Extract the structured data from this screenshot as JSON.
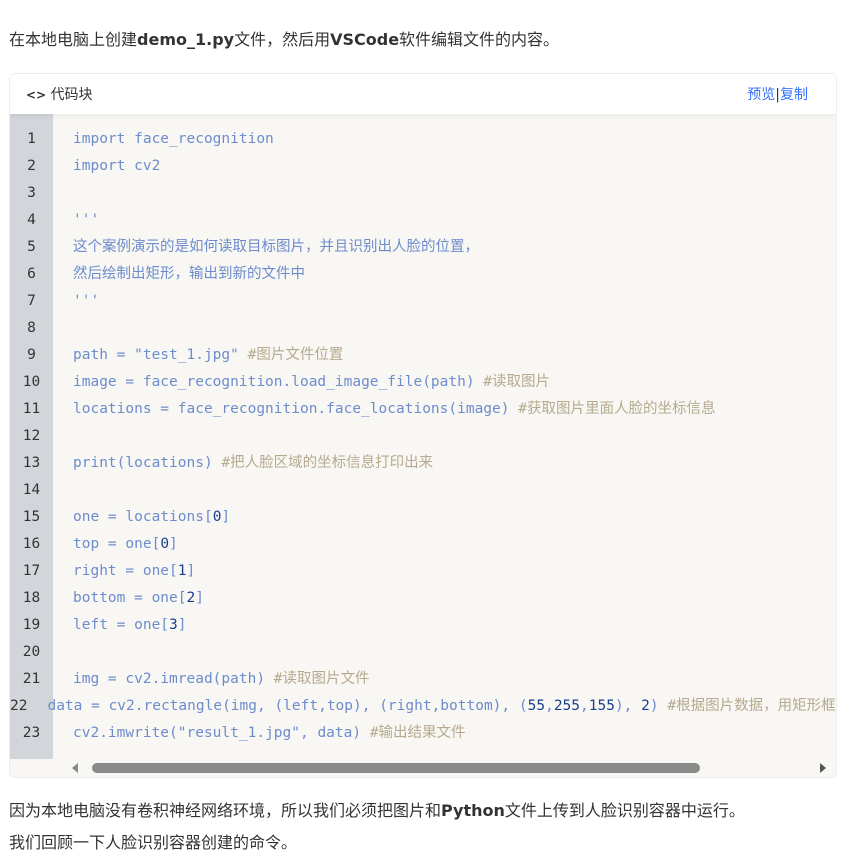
{
  "intro": {
    "pre": "在本地电脑上创建",
    "file": "demo_1.py",
    "mid": "文件，然后用",
    "app": "VSCode",
    "post": "软件编辑文件的内容。"
  },
  "codeblock": {
    "icon": "code-icon",
    "icon_text": "<>",
    "title": "代码块",
    "preview": "预览",
    "sep": "|",
    "copy": "复制"
  },
  "lines": [
    [
      [
        "k",
        "import face_recognition"
      ]
    ],
    [
      [
        "k",
        "import cv2"
      ]
    ],
    [],
    [
      [
        "k",
        "'''"
      ]
    ],
    [
      [
        "k",
        "这个案例演示的是如何读取目标图片，并且识别出人脸的位置，"
      ]
    ],
    [
      [
        "k",
        "然后绘制出矩形，输出到新的文件中"
      ]
    ],
    [
      [
        "k",
        "'''"
      ]
    ],
    [],
    [
      [
        "k",
        "path = "
      ],
      [
        "s",
        "\"test_1.jpg\""
      ],
      [
        "c",
        " #图片文件位置"
      ]
    ],
    [
      [
        "k",
        "image = face_recognition.load_image_file(path)"
      ],
      [
        "c",
        " #读取图片"
      ]
    ],
    [
      [
        "k",
        "locations = face_recognition.face_locations(image)"
      ],
      [
        "c",
        " #获取图片里面人脸的坐标信息"
      ]
    ],
    [],
    [
      [
        "k",
        "print(locations)"
      ],
      [
        "c",
        " #把人脸区域的坐标信息打印出来"
      ]
    ],
    [],
    [
      [
        "k",
        "one = locations["
      ],
      [
        "n",
        "0"
      ],
      [
        "k",
        "]"
      ]
    ],
    [
      [
        "k",
        "top = one["
      ],
      [
        "n",
        "0"
      ],
      [
        "k",
        "]"
      ]
    ],
    [
      [
        "k",
        "right = one["
      ],
      [
        "n",
        "1"
      ],
      [
        "k",
        "]"
      ]
    ],
    [
      [
        "k",
        "bottom = one["
      ],
      [
        "n",
        "2"
      ],
      [
        "k",
        "]"
      ]
    ],
    [
      [
        "k",
        "left = one["
      ],
      [
        "n",
        "3"
      ],
      [
        "k",
        "]"
      ]
    ],
    [],
    [
      [
        "k",
        "img = cv2.imread(path)"
      ],
      [
        "c",
        " #读取图片文件"
      ]
    ],
    [
      [
        "k",
        "data = cv2.rectangle(img, (left,top), (right,bottom), ("
      ],
      [
        "n",
        "55"
      ],
      [
        "k",
        ","
      ],
      [
        "n",
        "255"
      ],
      [
        "k",
        ","
      ],
      [
        "n",
        "155"
      ],
      [
        "k",
        "), "
      ],
      [
        "n",
        "2"
      ],
      [
        "k",
        ")"
      ],
      [
        "c",
        " #根据图片数据，用矩形框出人脸"
      ]
    ],
    [
      [
        "k",
        "cv2.imwrite("
      ],
      [
        "s",
        "\"result_1.jpg\""
      ],
      [
        "k",
        ", data)"
      ],
      [
        "c",
        " #输出结果文件"
      ]
    ]
  ],
  "outro": {
    "pre": "因为本地电脑没有卷积神经网络环境，所以我们必须把图片和",
    "lang": "Python",
    "post": "文件上传到人脸识别容器中运行。",
    "line2": "我们回顾一下人脸识别容器创建的命令。"
  }
}
